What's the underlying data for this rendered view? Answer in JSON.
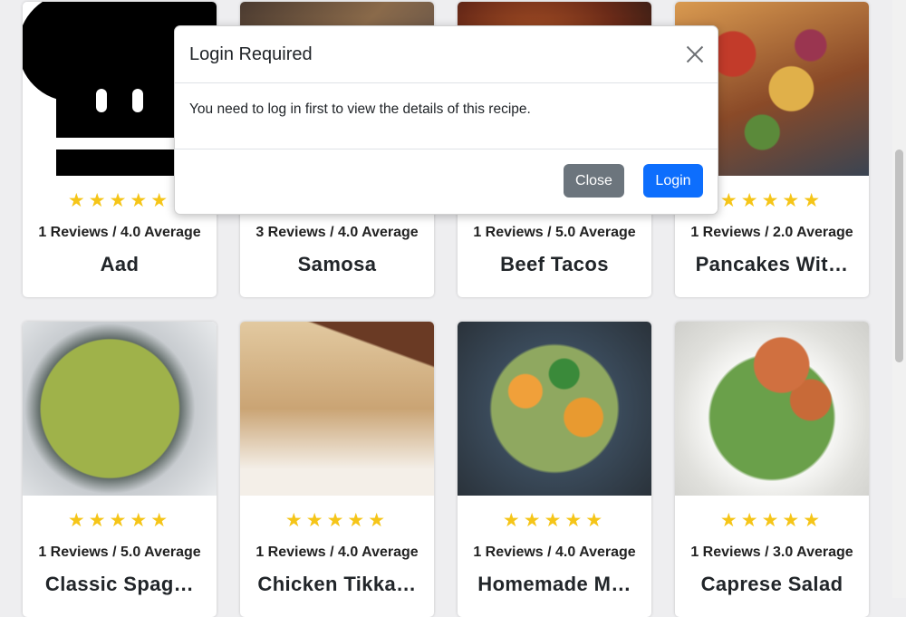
{
  "modal": {
    "title": "Login Required",
    "message": "You need to log in first to view the details of this recipe.",
    "close_button": "Close",
    "login_button": "Login"
  },
  "recipes": [
    {
      "title": "Aad",
      "reviews": "1 Reviews / 4.0 Average",
      "stars": "★★★★★",
      "rating": 4.0
    },
    {
      "title": "Samosa",
      "reviews": "3 Reviews / 4.0 Average",
      "stars": "★★★★★",
      "rating": 4.0
    },
    {
      "title": "Beef Tacos",
      "reviews": "1 Reviews / 5.0 Average",
      "stars": "★★★★★",
      "rating": 5.0
    },
    {
      "title": "Pancakes Wit…",
      "reviews": "1 Reviews / 2.0 Average",
      "stars": "★★★★★",
      "rating": 2.0
    },
    {
      "title": "Classic Spag…",
      "reviews": "1 Reviews / 5.0 Average",
      "stars": "★★★★★",
      "rating": 5.0
    },
    {
      "title": "Chicken Tikka…",
      "reviews": "1 Reviews / 4.0 Average",
      "stars": "★★★★★",
      "rating": 4.0
    },
    {
      "title": "Homemade M…",
      "reviews": "1 Reviews / 4.0 Average",
      "stars": "★★★★★",
      "rating": 4.0
    },
    {
      "title": "Caprese Salad",
      "reviews": "1 Reviews / 3.0 Average",
      "stars": "★★★★★",
      "rating": 3.0
    }
  ],
  "colors": {
    "star": "#f5c518",
    "primary": "#0d6efd",
    "secondary": "#6c757d"
  }
}
